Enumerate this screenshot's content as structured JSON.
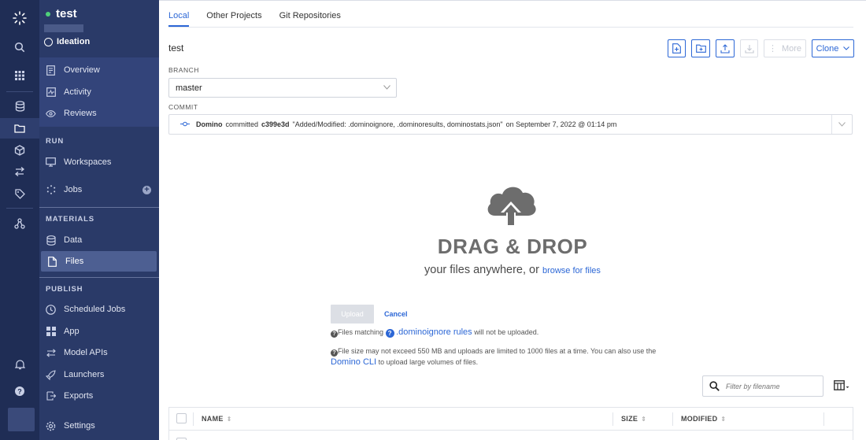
{
  "project": {
    "name": "test",
    "stage": "Ideation"
  },
  "nav": {
    "top_items": [
      {
        "label": "Overview"
      },
      {
        "label": "Activity"
      },
      {
        "label": "Reviews"
      }
    ],
    "run_section": "RUN",
    "run_items": [
      {
        "label": "Workspaces"
      },
      {
        "label": "Jobs"
      }
    ],
    "materials_section": "MATERIALS",
    "materials_items": [
      {
        "label": "Data"
      },
      {
        "label": "Files"
      }
    ],
    "publish_section": "PUBLISH",
    "publish_items": [
      {
        "label": "Scheduled Jobs"
      },
      {
        "label": "App"
      },
      {
        "label": "Model APIs"
      },
      {
        "label": "Launchers"
      },
      {
        "label": "Exports"
      },
      {
        "label": "Settings"
      }
    ]
  },
  "tabs": [
    {
      "label": "Local"
    },
    {
      "label": "Other Projects"
    },
    {
      "label": "Git Repositories"
    }
  ],
  "folder_title": "test",
  "toolbar": {
    "more_label": "More",
    "clone_label": "Clone"
  },
  "branch": {
    "label": "BRANCH",
    "value": "master"
  },
  "commit": {
    "label": "COMMIT",
    "author": "Domino",
    "verb": "committed",
    "hash": "c399e3d",
    "message": "\"Added/Modified: .dominoignore, .dominoresults, dominostats.json\"",
    "date_text": "on September 7, 2022 @ 01:14 pm"
  },
  "dropzone": {
    "title": "DRAG & DROP",
    "subtitle": "your files anywhere, or",
    "browse_link": "browse for files"
  },
  "upload": {
    "upload_label": "Upload",
    "cancel_label": "Cancel",
    "ignore_prefix": "Files matching",
    "ignore_link": ".dominoignore rules",
    "ignore_suffix": "will not be uploaded.",
    "size_note": "File size may not exceed 550 MB and uploads are limited to 1000 files at a time. You can also use the",
    "cli_link": "Domino CLI",
    "cli_suffix": "to upload large volumes of files."
  },
  "filter": {
    "placeholder": "Filter by filename"
  },
  "table": {
    "columns": [
      {
        "label": "NAME"
      },
      {
        "label": "SIZE"
      },
      {
        "label": "MODIFIED"
      }
    ]
  }
}
